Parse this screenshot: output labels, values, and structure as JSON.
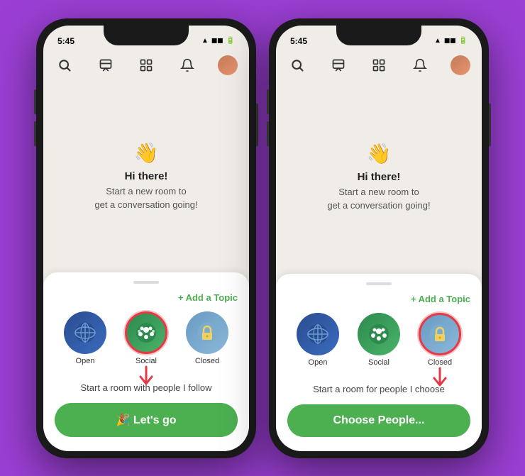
{
  "background_color": "#9b3fd4",
  "phones": [
    {
      "id": "phone-left",
      "status_bar": {
        "time": "5:45",
        "icons": "▲ ◼ ◼"
      },
      "nav_icons": [
        "search",
        "compose",
        "grid",
        "bell",
        "avatar"
      ],
      "main": {
        "emoji": "👋",
        "hi_text": "Hi there!",
        "sub_text": "Start a new room to\nget a conversation going!"
      },
      "sheet": {
        "add_topic": "+ Add a Topic",
        "room_types": [
          {
            "id": "open",
            "label": "Open",
            "selected": false
          },
          {
            "id": "social",
            "label": "Social",
            "selected": true
          },
          {
            "id": "closed",
            "label": "Closed",
            "selected": false
          }
        ],
        "description": "Start a room with people I follow",
        "button_label": "🎉 Let's go",
        "button_type": "green"
      }
    },
    {
      "id": "phone-right",
      "status_bar": {
        "time": "5:45",
        "icons": "▲ ◼ ◼"
      },
      "nav_icons": [
        "search",
        "compose",
        "grid",
        "bell",
        "avatar"
      ],
      "main": {
        "emoji": "👋",
        "hi_text": "Hi there!",
        "sub_text": "Start a new room to\nget a conversation going!"
      },
      "sheet": {
        "add_topic": "+ Add a Topic",
        "room_types": [
          {
            "id": "open",
            "label": "Open",
            "selected": false
          },
          {
            "id": "social",
            "label": "Social",
            "selected": false
          },
          {
            "id": "closed",
            "label": "Closed",
            "selected": true
          }
        ],
        "description": "Start a room for people I choose",
        "button_label": "Choose People...",
        "button_type": "green"
      }
    }
  ]
}
